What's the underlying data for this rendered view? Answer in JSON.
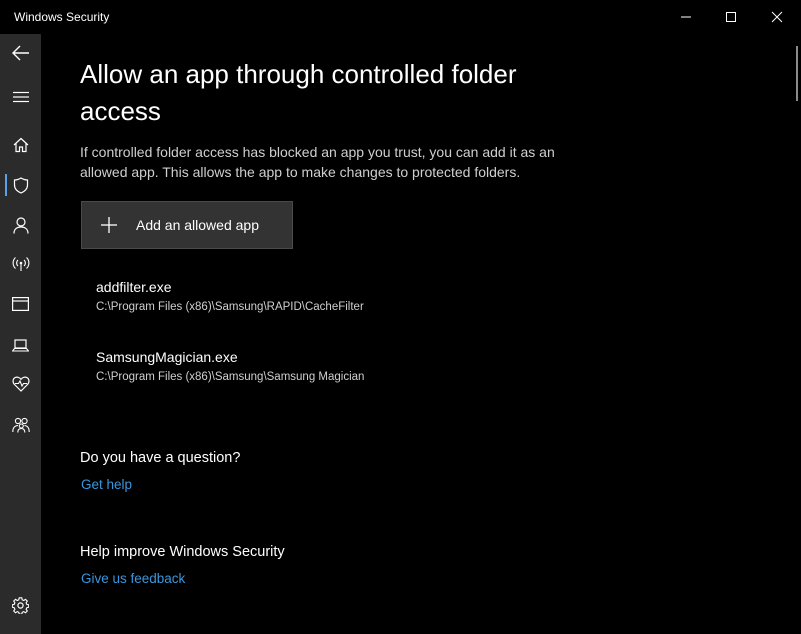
{
  "window": {
    "title": "Windows Security"
  },
  "sidebar": {
    "items": [
      {
        "name": "back-icon"
      },
      {
        "name": "menu-icon"
      },
      {
        "name": "home-icon"
      },
      {
        "name": "shield-icon"
      },
      {
        "name": "person-icon"
      },
      {
        "name": "wireless-icon"
      },
      {
        "name": "app-browser-icon"
      },
      {
        "name": "laptop-icon"
      },
      {
        "name": "heart-pulse-icon"
      },
      {
        "name": "family-icon"
      },
      {
        "name": "gear-icon"
      }
    ],
    "active": "shield-icon"
  },
  "page": {
    "title": "Allow an app through controlled folder access",
    "description": "If controlled folder access has blocked an app you trust, you can add it as an allowed app. This allows the app to make changes to protected folders.",
    "add_button_label": "Add an allowed app"
  },
  "allowed_apps": [
    {
      "name": "addfilter.exe",
      "path": "C:\\Program Files (x86)\\Samsung\\RAPID\\CacheFilter"
    },
    {
      "name": "SamsungMagician.exe",
      "path": "C:\\Program Files (x86)\\Samsung\\Samsung Magician"
    }
  ],
  "help": {
    "heading": "Do you have a question?",
    "link": "Get help"
  },
  "feedback": {
    "heading": "Help improve Windows Security",
    "link": "Give us feedback"
  },
  "colors": {
    "accent": "#3a96dd",
    "sidebar_bg": "#2b2b2b",
    "background": "#000000",
    "active_indicator": "#5aa0e6"
  }
}
